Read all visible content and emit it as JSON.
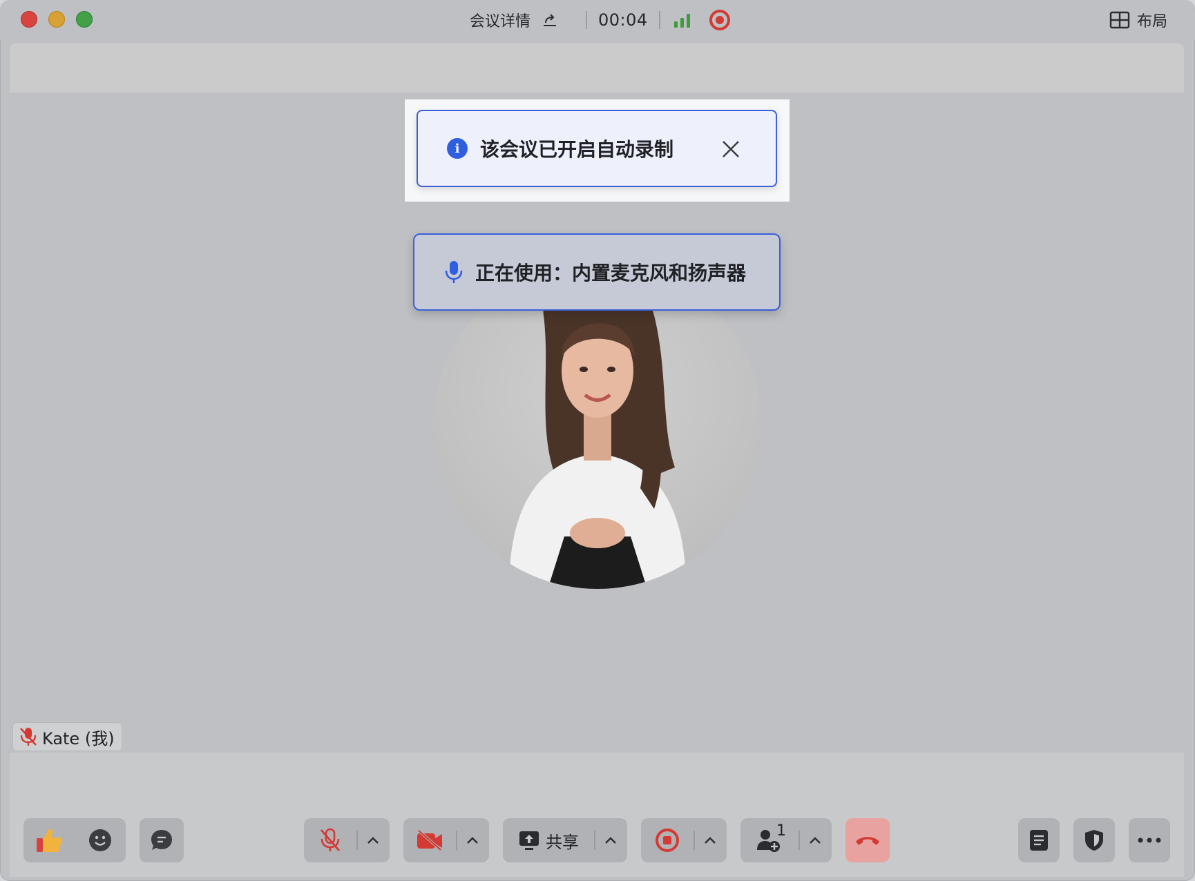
{
  "titlebar": {
    "meeting_detail": "会议详情",
    "timer": "00:04",
    "layout_label": "布局"
  },
  "notifications": {
    "auto_record": "该会议已开启自动录制",
    "device": "正在使用：内置麦克风和扬声器"
  },
  "participant": {
    "name": "Kate (我)",
    "mic_muted": true
  },
  "toolbar": {
    "share_label": "共享",
    "participants_count": "1"
  },
  "colors": {
    "accent_blue": "#3b5fd8",
    "record_red": "#d33a33",
    "signal_green": "#3e9b3f",
    "end_call": "#e8a3a1"
  },
  "icons": {
    "like": "thumbs-up-icon",
    "emoji": "smile-icon",
    "chat": "chat-icon",
    "mic": "mic-muted-icon",
    "camera": "camera-off-icon",
    "share": "share-screen-icon",
    "record": "record-icon",
    "participants": "add-participant-icon",
    "end": "hangup-icon",
    "notes": "notes-icon",
    "security": "shield-icon",
    "more": "more-icon"
  }
}
